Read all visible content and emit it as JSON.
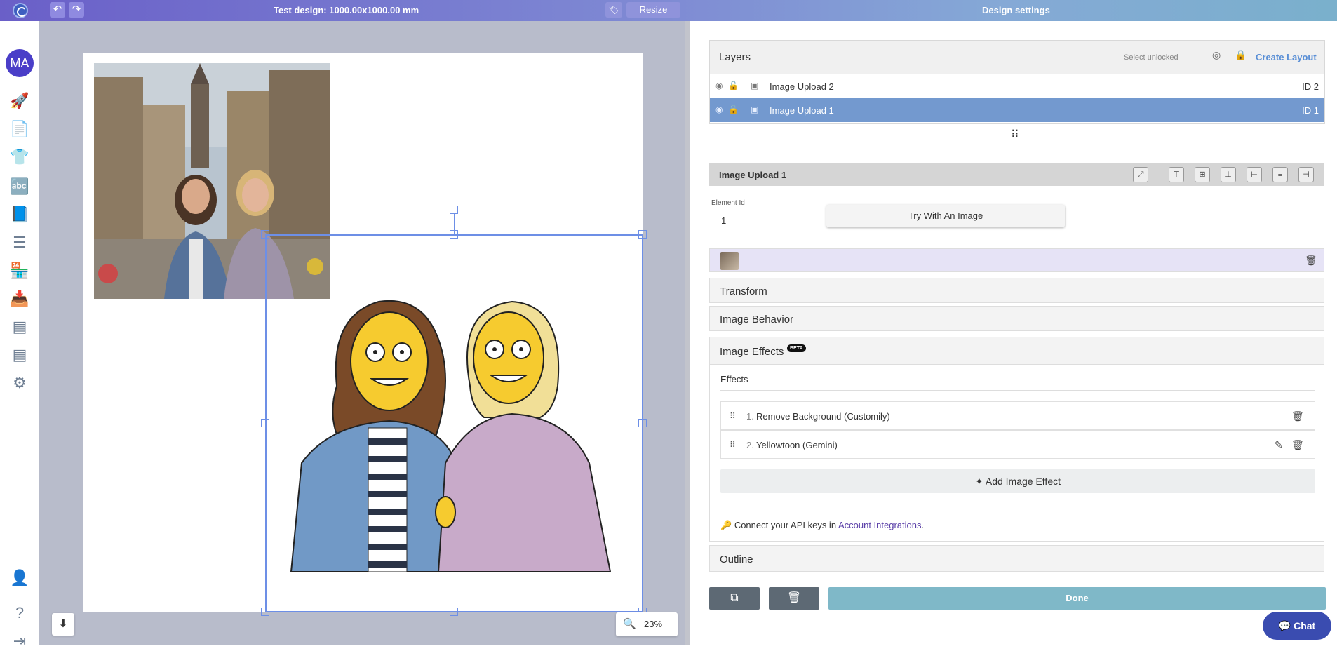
{
  "topbar": {
    "title": "Test design: 1000.00x1000.00 mm",
    "undo_icon": "undo-icon",
    "redo_icon": "redo-icon",
    "tag_icon": "tag-icon",
    "resize_label": "Resize",
    "settings_title": "Design settings"
  },
  "sidebar": {
    "avatar": "MA",
    "items": [
      {
        "icon": "rocket-icon",
        "glyph": "🚀"
      },
      {
        "icon": "document-icon",
        "glyph": "📄"
      },
      {
        "icon": "tshirt-icon",
        "glyph": "👕"
      },
      {
        "icon": "fonts-icon",
        "glyph": "🔤"
      },
      {
        "icon": "book-icon",
        "glyph": "📘"
      },
      {
        "icon": "list-icon",
        "glyph": "☰"
      },
      {
        "icon": "store-icon",
        "glyph": "🏪"
      },
      {
        "icon": "inbox-icon",
        "glyph": "📥"
      },
      {
        "icon": "table-list-icon",
        "glyph": "▤"
      },
      {
        "icon": "table-list-2-icon",
        "glyph": "▤"
      },
      {
        "icon": "settings-icon",
        "glyph": "⚙"
      }
    ],
    "bottom_items": [
      {
        "icon": "user-settings-icon",
        "glyph": "👤"
      },
      {
        "icon": "help-icon",
        "glyph": "?"
      },
      {
        "icon": "logout-icon",
        "glyph": "⇥"
      }
    ]
  },
  "canvas": {
    "zoom": "23%",
    "download_icon": "download-icon"
  },
  "layers": {
    "title": "Layers",
    "select_unlocked": "Select unlocked",
    "create_layout": "Create Layout",
    "rows": [
      {
        "name": "Image Upload 2",
        "id": "ID 2",
        "active": false
      },
      {
        "name": "Image Upload 1",
        "id": "ID 1",
        "active": true
      }
    ]
  },
  "element": {
    "title": "Image Upload 1",
    "element_id_label": "Element Id",
    "element_id_value": "1",
    "try_button": "Try With An Image",
    "sections": {
      "transform": "Transform",
      "image_behavior": "Image Behavior",
      "image_effects": "Image Effects",
      "beta": "BETA",
      "outline": "Outline"
    },
    "effects_label": "Effects",
    "effects": [
      {
        "num": "1.",
        "name": "Remove Background (Customily)",
        "editable": false
      },
      {
        "num": "2.",
        "name": "Yellowtoon (Gemini)",
        "editable": true
      }
    ],
    "add_effect": "Add Image Effect",
    "api_text": "Connect your API keys in ",
    "api_link": "Account Integrations",
    "api_period": "."
  },
  "footer": {
    "done": "Done",
    "chat": "Chat"
  },
  "colors": {
    "accent": "#6a5fc8",
    "selected_row": "#7399cf",
    "done_button": "#7fb8c8",
    "chat": "#3a4cb0"
  }
}
